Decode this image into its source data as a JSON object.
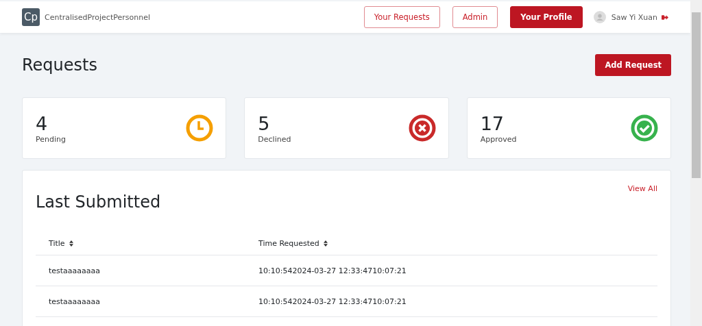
{
  "navbar": {
    "logo": "Cp",
    "brand": "CentralisedProjectPersonnel",
    "buttons": [
      {
        "label": "Your Requests",
        "selected": false
      },
      {
        "label": "Admin",
        "selected": false
      },
      {
        "label": "Your Profile",
        "selected": true
      }
    ],
    "user": "Saw Yi Xuan"
  },
  "page": {
    "title": "Requests",
    "action": "Add Request"
  },
  "stats": [
    {
      "count": "4",
      "label": "Pending",
      "kind": "pending",
      "color": "#f59f00"
    },
    {
      "count": "5",
      "label": "Declined",
      "kind": "declined",
      "color": "#c92a2a"
    },
    {
      "count": "17",
      "label": "Approved",
      "kind": "approved",
      "color": "#37b24d"
    }
  ],
  "table": {
    "title": "Last Submitted",
    "link": "View All",
    "columns": [
      "Title",
      "Time Requested"
    ],
    "rows": [
      [
        "testaaaaaaaa",
        "10:10:542024-03-27 12:33:4710:07:21"
      ],
      [
        "testaaaaaaaa",
        "10:10:542024-03-27 12:33:4710:07:21"
      ]
    ]
  }
}
